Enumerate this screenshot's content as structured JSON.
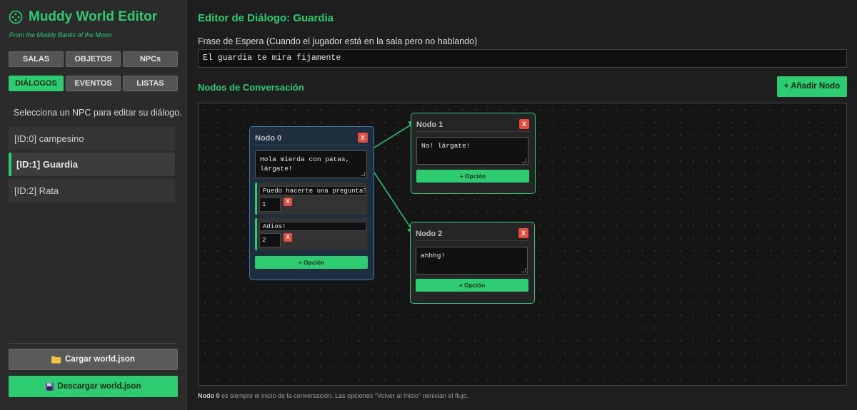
{
  "app": {
    "title": "Muddy World Editor",
    "subtitle": "From the Muddy Banks of the Moon",
    "accent_color": "#2ecc71"
  },
  "nav": {
    "salas": "SALAS",
    "objetos": "OBJETOS",
    "npcs": "NPCs",
    "dialogos": "DIÁLOGOS",
    "eventos": "EVENTOS",
    "listas": "LISTAS",
    "active": "DIÁLOGOS"
  },
  "sidebar": {
    "hint": "Selecciona un NPC para editar su diálogo.",
    "npcs": [
      {
        "label": "[ID:0] campesino",
        "selected": false
      },
      {
        "label": "[ID:1] Guardia",
        "selected": true
      },
      {
        "label": "[ID:2] Rata",
        "selected": false
      }
    ],
    "load_label": "Cargar world.json",
    "load_icon": "folder-icon",
    "save_label": "Descargar world.json",
    "save_icon": "floppy-disk-icon"
  },
  "editor": {
    "title": "Editor de Diálogo: Guardia",
    "idle_label": "Frase de Espera (Cuando el jugador está en la sala pero no hablando)",
    "idle_value": "El guardia te mira fijamente",
    "nodes_title": "Nodos de Conversación",
    "add_node_label": "+ Añadir Nodo"
  },
  "nodes": [
    {
      "title": "Nodo 0",
      "text_line1": "Hola mierda con patas,",
      "text_line2": "lárgate!",
      "options": [
        {
          "text": "Puedo hacerte una pregunta?",
          "target": "1"
        },
        {
          "text": "Adios!",
          "target": "2"
        }
      ]
    },
    {
      "title": "Nodo 1",
      "text_line1": "No! lárgate!",
      "options": []
    },
    {
      "title": "Nodo 2",
      "text_line1": "ahhhg!",
      "options": []
    }
  ],
  "node_ui": {
    "delete_label": "X",
    "option_delete_label": "X",
    "add_option_label": "+ Opción"
  },
  "footer": {
    "bold": "Nodo 0",
    "rest": " es siempre el inicio de la conversación. Las opciones \"Volver al Inicio\" reinician el flujo."
  }
}
